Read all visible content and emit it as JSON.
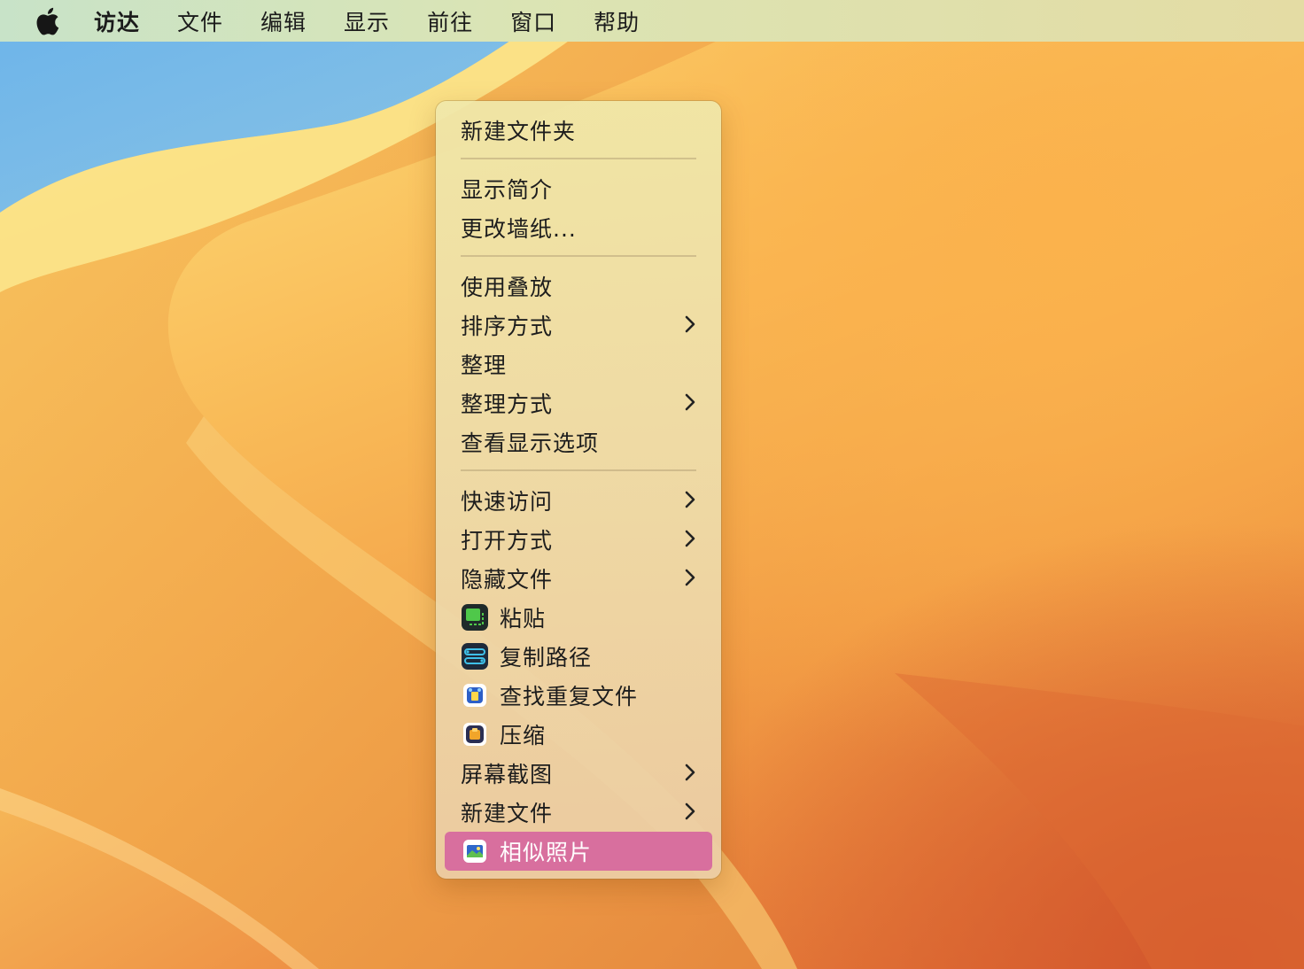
{
  "menubar": {
    "apple_icon": "apple-logo-icon",
    "items": [
      {
        "label": "访达",
        "app": true
      },
      {
        "label": "文件"
      },
      {
        "label": "编辑"
      },
      {
        "label": "显示"
      },
      {
        "label": "前往"
      },
      {
        "label": "窗口"
      },
      {
        "label": "帮助"
      }
    ]
  },
  "context_menu": {
    "groups": [
      [
        {
          "label": "新建文件夹"
        }
      ],
      [
        {
          "label": "显示简介"
        },
        {
          "label": "更改墙纸..."
        }
      ],
      [
        {
          "label": "使用叠放"
        },
        {
          "label": "排序方式",
          "submenu": true
        },
        {
          "label": "整理"
        },
        {
          "label": "整理方式",
          "submenu": true
        },
        {
          "label": "查看显示选项"
        }
      ],
      [
        {
          "label": "快速访问",
          "submenu": true
        },
        {
          "label": "打开方式",
          "submenu": true
        },
        {
          "label": "隐藏文件",
          "submenu": true
        },
        {
          "label": "粘贴",
          "icon": "paste-app-icon"
        },
        {
          "label": "复制路径",
          "icon": "copy-path-app-icon"
        },
        {
          "label": "查找重复文件",
          "icon": "duplicate-finder-app-icon"
        },
        {
          "label": "压缩",
          "icon": "archive-app-icon"
        },
        {
          "label": "屏幕截图",
          "submenu": true
        },
        {
          "label": "新建文件",
          "submenu": true
        },
        {
          "label": "相似照片",
          "icon": "similar-photos-app-icon",
          "highlighted": true
        }
      ]
    ]
  },
  "colors": {
    "highlight": "#d86f9e",
    "menubar_text": "#1b1b1b"
  }
}
